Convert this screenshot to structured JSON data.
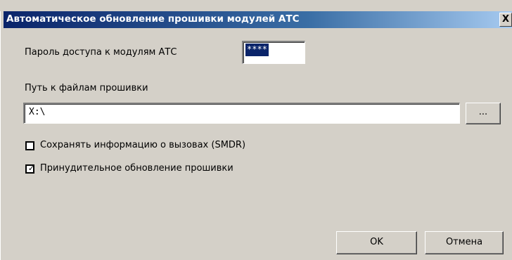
{
  "window": {
    "title": "Автоматическое обновление прошивки модулей АТС",
    "close_label": "X"
  },
  "password": {
    "label": "Пароль доступа к модулям АТС",
    "value": "****"
  },
  "firmware_path": {
    "label": "Путь к файлам прошивки",
    "value": "X:\\",
    "browse_label": "..."
  },
  "options": {
    "save_smdr": {
      "label": "Сохранять информацию о вызовах (SMDR)",
      "checked": false
    },
    "force_update": {
      "label": "Принудительное обновление прошивки",
      "checked": true,
      "mark": "✓"
    }
  },
  "buttons": {
    "ok_label": "OK",
    "cancel_label": "Отмена"
  },
  "colors": {
    "face": "#d4d0c8",
    "titlebar": "#0a246a",
    "selection": "#0a246a"
  }
}
